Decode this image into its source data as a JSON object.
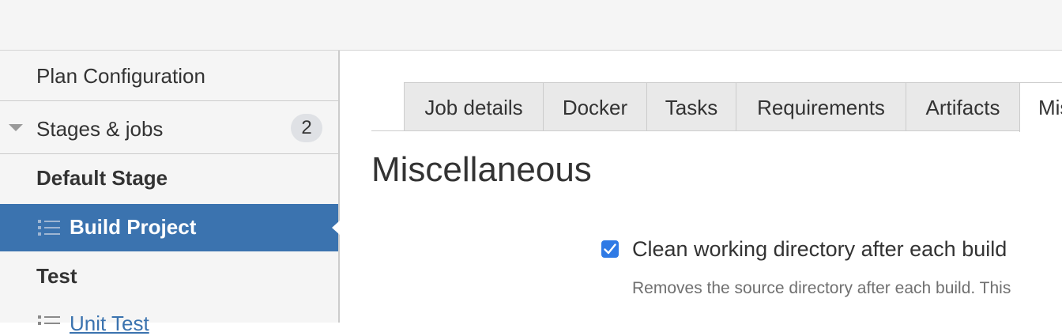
{
  "sidebar": {
    "plan_configuration": "Plan Configuration",
    "stages_jobs": "Stages & jobs",
    "stages_count": "2",
    "stages": [
      {
        "name": "Default Stage",
        "jobs": [
          "Build Project"
        ]
      },
      {
        "name": "Test",
        "jobs": [
          "Unit Test"
        ]
      }
    ],
    "selected_job": "Build Project",
    "next_job": "Unit Test"
  },
  "tabs": [
    {
      "label": "Job details"
    },
    {
      "label": "Docker"
    },
    {
      "label": "Tasks"
    },
    {
      "label": "Requirements"
    },
    {
      "label": "Artifacts"
    },
    {
      "label": "Miscellaneous"
    }
  ],
  "active_tab": "Miscellaneous",
  "page": {
    "title": "Miscellaneous",
    "clean_dir_label": "Clean working directory after each build",
    "clean_dir_checked": true,
    "clean_dir_description": "Removes the source directory after each build. This"
  },
  "colors": {
    "selected_bg": "#3b73af",
    "link": "#3b73af",
    "checkbox": "#2f7ae5"
  }
}
